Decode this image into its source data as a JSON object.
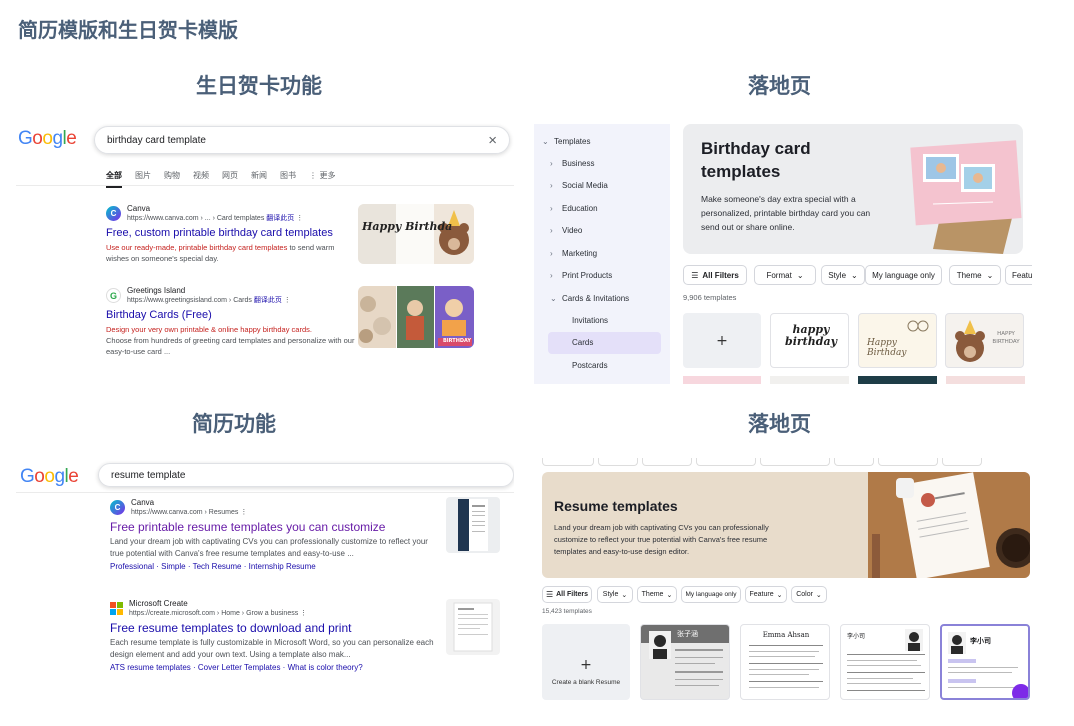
{
  "main_title": "简历模版和生日贺卡模版",
  "sections": {
    "birthday_feature": "生日贺卡功能",
    "landing_top": "落地页",
    "resume_feature": "简历功能",
    "landing_bottom": "落地页"
  },
  "google_birthday": {
    "logo": "Google",
    "query": "birthday card template",
    "close_icon": "×",
    "tabs": [
      "全部",
      "图片",
      "购物",
      "视频",
      "网页",
      "新闻",
      "图书",
      "⋮ 更多"
    ],
    "results": [
      {
        "site": "Canva",
        "url": "https://www.canva.com › ... › Card templates",
        "translate": "翻译此页",
        "title": "Free, custom printable birthday card templates",
        "desc_hl": "Use our ready-made, printable birthday card templates",
        "desc_rest": "to send warm wishes on someone's special day."
      },
      {
        "site": "Greetings Island",
        "url": "https://www.greetingsisland.com › Cards",
        "translate": "翻译此页",
        "title": "Birthday Cards (Free)",
        "desc_hl": "Design your very own printable & online happy birthday cards.",
        "desc_rest": "Choose from hundreds of greeting card templates and personalize with our easy-to-use card ..."
      }
    ],
    "thumb1_text": "Happy Birthda",
    "thumb2_text": "BIRTHDAY"
  },
  "canva_birthday": {
    "sidebar": {
      "root": "Templates",
      "items": [
        "Business",
        "Social Media",
        "Education",
        "Video",
        "Marketing",
        "Print Products",
        "Cards & Invitations"
      ],
      "sub_items": [
        "Invitations",
        "Cards",
        "Postcards"
      ]
    },
    "hero_title": "Birthday card templates",
    "hero_desc": "Make someone's day extra special with a personalized, printable birthday card you can send out or share online.",
    "filters": [
      "All Filters",
      "Format",
      "Style",
      "My language only",
      "Theme",
      "Featu"
    ],
    "count": "9,906 templates",
    "card_texts": [
      "happy birthday",
      "Happy Birthday",
      "HAPPY BIRTHDAY"
    ],
    "plus": "+"
  },
  "google_resume": {
    "logo": "Google",
    "query": "resume template",
    "results": [
      {
        "site": "Canva",
        "url": "https://www.canva.com › Resumes",
        "title": "Free printable resume templates you can customize",
        "desc": "Land your dream job with captivating CVs you can professionally customize to reflect your true potential with Canva's free resume templates and easy-to-use ...",
        "links": [
          "Professional",
          "Simple",
          "Tech Resume",
          "Internship Resume"
        ]
      },
      {
        "site": "Microsoft Create",
        "url": "https://create.microsoft.com › Home › Grow a business",
        "title": "Free resume templates to download and print",
        "desc": "Each resume template is fully customizable in Microsoft Word, so you can personalize each design element and add your own text. Using a template also mak...",
        "links": [
          "ATS resume templates",
          "Cover Letter Templates",
          "What is color theory?"
        ]
      }
    ]
  },
  "canva_resume": {
    "hero_title": "Resume templates",
    "hero_desc": "Land your dream job with captivating CVs you can professionally customize to reflect your true potential with Canva's free resume templates and easy-to-use design editor.",
    "filters": [
      "All Filters",
      "Style",
      "Theme",
      "My language only",
      "Feature",
      "Color"
    ],
    "count": "15,423 templates",
    "blank_label": "Create a blank Resume",
    "plus": "+",
    "card_names": [
      "张子涵",
      "Emma Ahsan",
      "李小司",
      "李小司"
    ]
  },
  "colors": {
    "title": "#4a5f78",
    "link": "#1a0dab",
    "visited": "#681da8",
    "highlight": "#c5221f",
    "canva_purple": "#7d2ae8"
  }
}
